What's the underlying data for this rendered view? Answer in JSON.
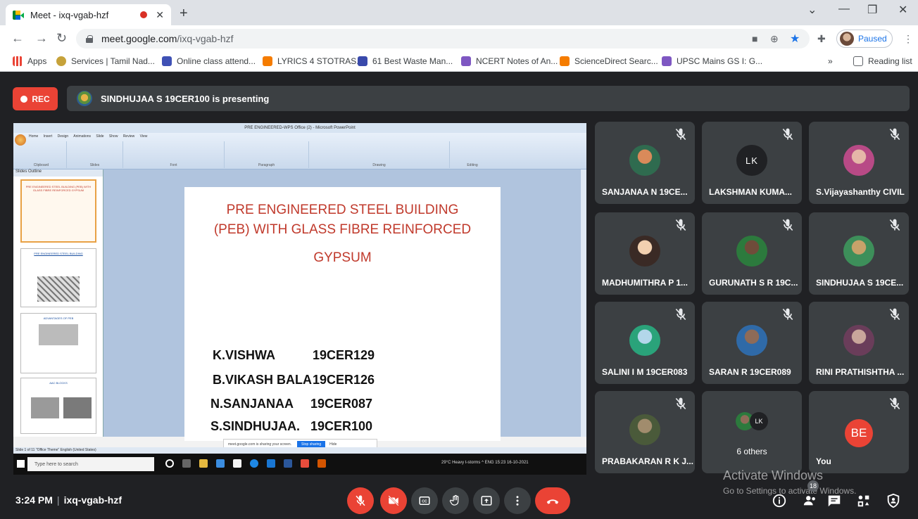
{
  "browser": {
    "tab_title": "Meet - ixq-vgab-hzf",
    "url_host": "meet.google.com",
    "url_path": "/ixq-vgab-hzf",
    "profile_status": "Paused",
    "bookmarks": [
      {
        "label": "Apps",
        "color": "#4285f4"
      },
      {
        "label": "Services | Tamil Nad...",
        "color": "#c6a23a"
      },
      {
        "label": "Online class attend...",
        "color": "#3f51b5"
      },
      {
        "label": "LYRICS 4 STOTRAS...",
        "color": "#f57c00"
      },
      {
        "label": "61 Best Waste Man...",
        "color": "#3949ab"
      },
      {
        "label": "NCERT Notes of An...",
        "color": "#7e57c2"
      },
      {
        "label": "ScienceDirect Searc...",
        "color": "#f57c00"
      },
      {
        "label": "UPSC Mains GS I: G...",
        "color": "#7e57c2"
      }
    ],
    "reading_list": "Reading list",
    "more_bookmarks": "»"
  },
  "meet": {
    "rec_label": "REC",
    "presenting_text": "SINDHUJAA S 19CER100 is presenting",
    "meeting_time": "3:24 PM",
    "meeting_code": "ixq-vgab-hzf",
    "people_count": "18",
    "watermark_title": "Activate Windows",
    "watermark_sub": "Go to Settings to activate Windows."
  },
  "presentation": {
    "window_title": "PRE ENGINEERED-WPS Office (2) - Microsoft PowerPoint",
    "ribbon_tabs": "Home Insert Design Animations Slide Show Review View",
    "ribbon_groups": [
      "Clipboard",
      "Slides",
      "Font",
      "Paragraph",
      "Drawing",
      "Editing"
    ],
    "pane_tabs": "Slides  Outline",
    "slide_title_1": "PRE ENGINEERED STEEL BUILDING",
    "slide_title_2": "(PEB) WITH GLASS FIBRE REINFORCED",
    "slide_title_3": "GYPSUM",
    "members": [
      {
        "name": "K.VISHWA",
        "code": "19CER129"
      },
      {
        "name": "B.VIKASH BALA",
        "code": "19CER126"
      },
      {
        "name": "N.SANJANAA",
        "code": "19CER087"
      },
      {
        "name": "S.SINDHUJAA.",
        "code": "19CER100"
      }
    ],
    "share_text": "meet.google.com is sharing your screen.",
    "stop_sharing": "Stop sharing",
    "hide": "Hide",
    "status_bar": "Slide 1 of 11   \"Office Theme\"   English (United States)",
    "taskbar_search": "Type here to search",
    "taskbar_weather": "29°C  Heavy t-storms",
    "taskbar_lang": "ENG",
    "taskbar_time": "15:23",
    "taskbar_date": "16-10-2021",
    "thumb1": "PRE ENGINEERED STEEL BUILDING (PEB) WITH GLASS FIBRE REINFORCED GYPSUM",
    "thumb2": "PRE ENGINEERED STEEL BUILDING",
    "thumb3": "ADVANTAGES OF PEB",
    "thumb4": "AAC BLOCKS"
  },
  "participants": [
    {
      "name": "SANJANAA N 19CE...",
      "avatar": "photo",
      "muted": true
    },
    {
      "name": "LAKSHMAN KUMA...",
      "avatar": "LK",
      "muted": true
    },
    {
      "name": "S.Vijayashanthy CIVIL",
      "avatar": "photo",
      "muted": true
    },
    {
      "name": "MADHUMITHRA P 1...",
      "avatar": "photo",
      "muted": true
    },
    {
      "name": "GURUNATH S R 19C...",
      "avatar": "photo",
      "muted": true
    },
    {
      "name": "SINDHUJAA S 19CE...",
      "avatar": "photo",
      "muted": true
    },
    {
      "name": "SALINI I M 19CER083",
      "avatar": "photo",
      "muted": true
    },
    {
      "name": "SARAN R 19CER089",
      "avatar": "photo",
      "muted": true
    },
    {
      "name": "RINI PRATHISHTHA ...",
      "avatar": "photo",
      "muted": true
    },
    {
      "name": "PRABAKARAN R K J...",
      "avatar": "photo",
      "muted": true
    },
    {
      "name": "6 others",
      "avatar": "group",
      "muted": false
    },
    {
      "name": "You",
      "avatar": "BE",
      "muted": true
    }
  ],
  "colors": {
    "meet_bg": "#202124",
    "tile_bg": "#3c4043",
    "red": "#ea4335",
    "slide_title": "#c0392b"
  }
}
